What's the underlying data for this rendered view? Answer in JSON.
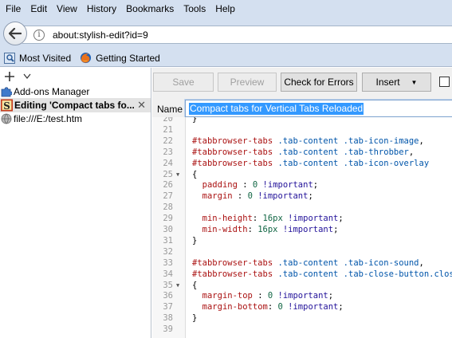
{
  "menu": [
    "File",
    "Edit",
    "View",
    "History",
    "Bookmarks",
    "Tools",
    "Help"
  ],
  "url": "about:stylish-edit?id=9",
  "bookmarks": [
    {
      "label": "Most Visited"
    },
    {
      "label": "Getting Started"
    }
  ],
  "sidebar": {
    "tabs": [
      {
        "label": "Add-ons Manager"
      },
      {
        "label": "Editing 'Compact tabs fo..."
      },
      {
        "label": "file:///E:/test.htm"
      }
    ]
  },
  "editor": {
    "save_label": "Save",
    "preview_label": "Preview",
    "check_label": "Check for Errors",
    "insert_label": "Insert",
    "name_label": "Name",
    "name_value": "Compact tabs for Vertical Tabs Reloaded",
    "lines": [
      {
        "n": "20",
        "text": "}"
      },
      {
        "n": "21",
        "text": ""
      },
      {
        "n": "22",
        "text": "#tabbrowser-tabs .tab-content .tab-icon-image,"
      },
      {
        "n": "23",
        "text": "#tabbrowser-tabs .tab-content .tab-throbber,"
      },
      {
        "n": "24",
        "text": "#tabbrowser-tabs .tab-content .tab-icon-overlay"
      },
      {
        "n": "25",
        "text": "{"
      },
      {
        "n": "26",
        "text": "  padding : 0 !important;"
      },
      {
        "n": "27",
        "text": "  margin : 0 !important;"
      },
      {
        "n": "28",
        "text": ""
      },
      {
        "n": "29",
        "text": "  min-height: 16px !important;"
      },
      {
        "n": "30",
        "text": "  min-width: 16px !important;"
      },
      {
        "n": "31",
        "text": "}"
      },
      {
        "n": "32",
        "text": ""
      },
      {
        "n": "33",
        "text": "#tabbrowser-tabs .tab-content .tab-icon-sound,"
      },
      {
        "n": "34",
        "text": "#tabbrowser-tabs .tab-content .tab-close-button.close-i"
      },
      {
        "n": "35",
        "text": "{"
      },
      {
        "n": "36",
        "text": "  margin-top : 0 !important;"
      },
      {
        "n": "37",
        "text": "  margin-bottom: 0 !important;"
      },
      {
        "n": "38",
        "text": "}"
      },
      {
        "n": "39",
        "text": ""
      }
    ]
  }
}
